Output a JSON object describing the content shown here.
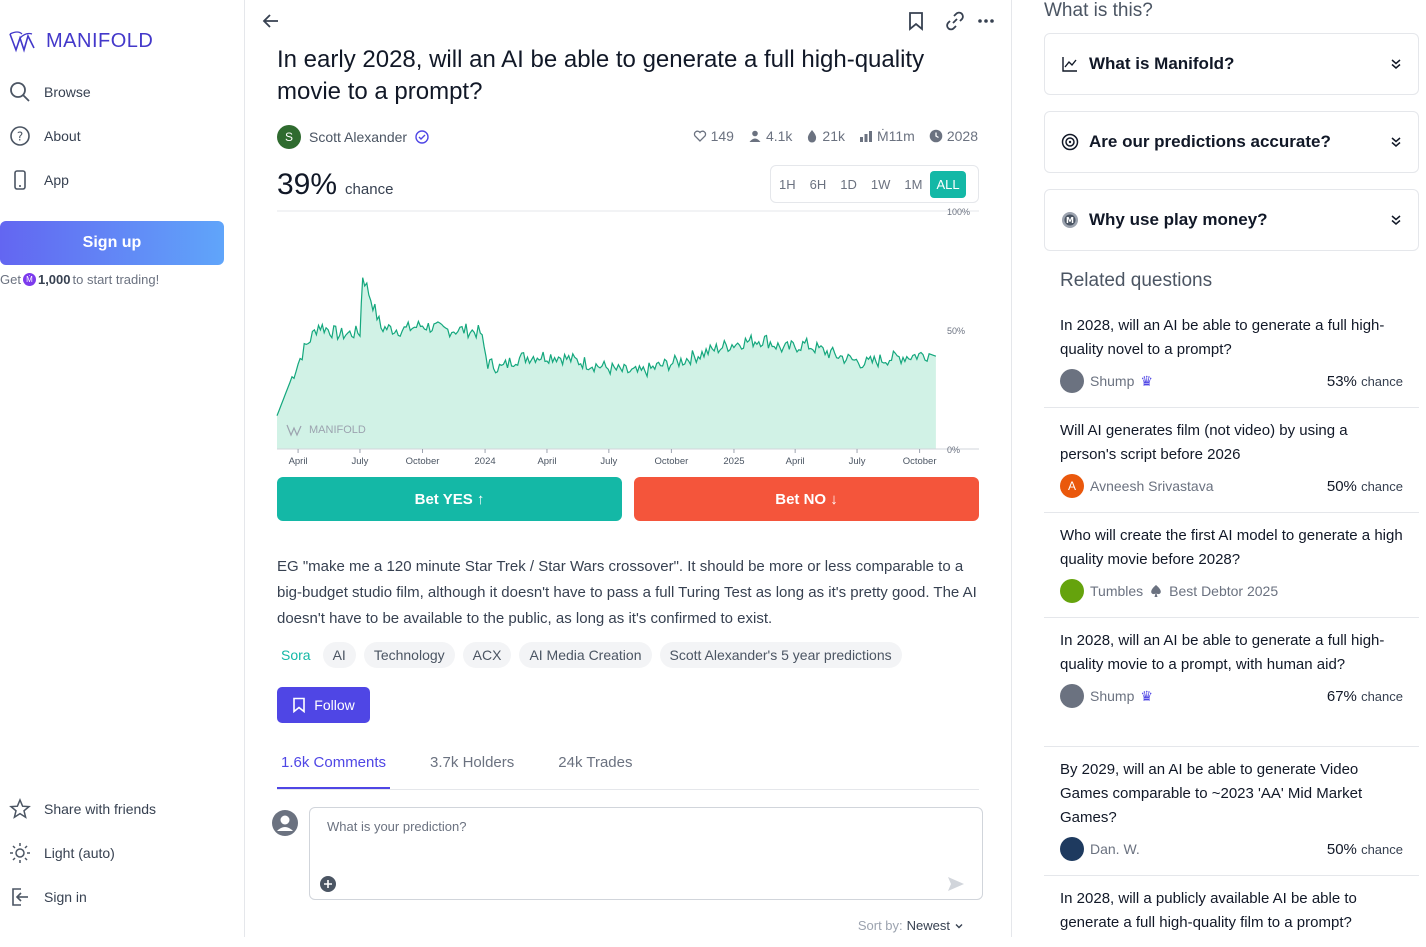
{
  "brand": {
    "name": "MANIFOLD",
    "watermark": "MANIFOLD"
  },
  "sidebar": {
    "nav": [
      {
        "label": "Browse",
        "icon": "search-icon"
      },
      {
        "label": "About",
        "icon": "question-circle-icon"
      },
      {
        "label": "App",
        "icon": "phone-icon"
      }
    ],
    "signup_label": "Sign up",
    "signup_note_prefix": "Get",
    "signup_note_amount": "1,000",
    "signup_note_suffix": "to start trading!",
    "bottom": [
      {
        "label": "Share with friends",
        "icon": "star-icon"
      },
      {
        "label": "Light (auto)",
        "icon": "sun-icon"
      },
      {
        "label": "Sign in",
        "icon": "sign-in-icon"
      }
    ]
  },
  "market": {
    "title": "In early 2028, will an AI be able to generate a full high-quality movie to a prompt?",
    "author": "Scott Alexander",
    "author_initial": "S",
    "stats": {
      "likes": "149",
      "traders": "4.1k",
      "volume": "21k",
      "liquidity": "Ṁ11m",
      "close": "2028"
    },
    "probability": "39%",
    "probability_label": "chance",
    "ranges": [
      "1H",
      "6H",
      "1D",
      "1W",
      "1M",
      "ALL"
    ],
    "active_range": "ALL",
    "bet_yes": "Bet YES ↑",
    "bet_no": "Bet NO ↓",
    "description": "EG \"make me a 120 minute Star Trek / Star Wars crossover\". It should be more or less comparable to a big-budget studio film, although it doesn't have to pass a full Turing Test as long as it's pretty good. The AI doesn't have to be available to the public, as long as it's confirmed to exist.",
    "tags": [
      "Sora",
      "AI",
      "Technology",
      "ACX",
      "AI Media Creation",
      "Scott Alexander's 5 year predictions"
    ],
    "follow_label": "Follow",
    "tabs": [
      "1.6k Comments",
      "3.7k Holders",
      "24k Trades"
    ],
    "comment_placeholder": "What is your prediction?",
    "sort_label": "Sort by:",
    "sort_value": "Newest"
  },
  "chart_data": {
    "type": "area",
    "ylim": [
      0,
      100
    ],
    "y_ticks": [
      "100%",
      "50%",
      "0%"
    ],
    "x_ticks": [
      "April",
      "July",
      "October",
      "2024",
      "April",
      "July",
      "October",
      "2025",
      "April",
      "July",
      "October"
    ],
    "x": [
      "2023-03-01",
      "2023-03-20",
      "2023-04-10",
      "2023-05-01",
      "2023-06-01",
      "2023-07-01",
      "2023-07-05",
      "2023-08-01",
      "2023-09-01",
      "2023-10-01",
      "2023-11-01",
      "2023-12-01",
      "2023-12-25",
      "2024-01-05",
      "2024-01-25",
      "2024-02-15",
      "2024-03-15",
      "2024-04-15",
      "2024-05-15",
      "2024-06-15",
      "2024-07-15",
      "2024-08-15",
      "2024-09-15",
      "2024-10-15",
      "2024-11-15",
      "2024-12-15",
      "2025-01-15",
      "2025-02-15",
      "2025-03-15",
      "2025-04-15",
      "2025-05-15",
      "2025-06-15",
      "2025-07-15",
      "2025-08-15",
      "2025-09-15",
      "2025-10-15",
      "2025-10-25"
    ],
    "values": [
      14,
      28,
      42,
      52,
      48,
      49,
      73,
      51,
      50,
      52,
      50,
      50,
      49,
      36,
      34,
      38,
      39,
      39,
      37,
      35,
      33,
      32,
      35,
      37,
      40,
      43,
      45,
      46,
      42,
      44,
      41,
      38,
      36,
      38,
      39,
      40,
      39
    ],
    "series_color": "#14a77d",
    "fill_color": "#d1f2e6"
  },
  "right": {
    "what_label": "What is this?",
    "faq": [
      {
        "label": "What is Manifold?",
        "icon": "chart-line-icon"
      },
      {
        "label": "Are our predictions accurate?",
        "icon": "target-icon"
      },
      {
        "label": "Why use play money?",
        "icon": "mana-coin-icon"
      }
    ],
    "related_heading": "Related questions",
    "related": [
      {
        "question": "In 2028, will an AI be able to generate a full high-quality novel to a prompt?",
        "author": "Shump",
        "author_initial": "",
        "badge": "♛",
        "prob": "53%",
        "chance": "chance",
        "avatar_color": "#6b7280"
      },
      {
        "question": "Will AI generates film (not video) by using a person's script before 2026",
        "author": "Avneesh Srivastava",
        "author_initial": "A",
        "badge": "",
        "prob": "50%",
        "chance": "chance",
        "avatar_color": "#ea580c"
      },
      {
        "question": "Who will create the first AI model to generate a high quality movie before 2028?",
        "author": "Tumbles",
        "author_initial": "",
        "badge": "Best Debtor 2025",
        "prob": "",
        "chance": "",
        "avatar_color": "#65a30d"
      },
      {
        "question": "In 2028, will an AI be able to generate a full high-quality movie to a prompt, with human aid?",
        "author": "Shump",
        "author_initial": "",
        "badge": "♛",
        "prob": "67%",
        "chance": "chance",
        "avatar_color": "#6b7280"
      },
      {
        "question": "By 2029, will an AI be able to generate Video Games comparable to ~2023 'AA' Mid Market Games?",
        "author": "Dan. W.",
        "author_initial": "",
        "badge": "",
        "prob": "50%",
        "chance": "chance",
        "avatar_color": "#1e3a5f"
      },
      {
        "question": "In 2028, will a publicly available AI be able to generate a full high-quality film to a prompt?",
        "author": "",
        "author_initial": "",
        "badge": "",
        "prob": "",
        "chance": "",
        "avatar_color": "#6b7280"
      }
    ]
  }
}
